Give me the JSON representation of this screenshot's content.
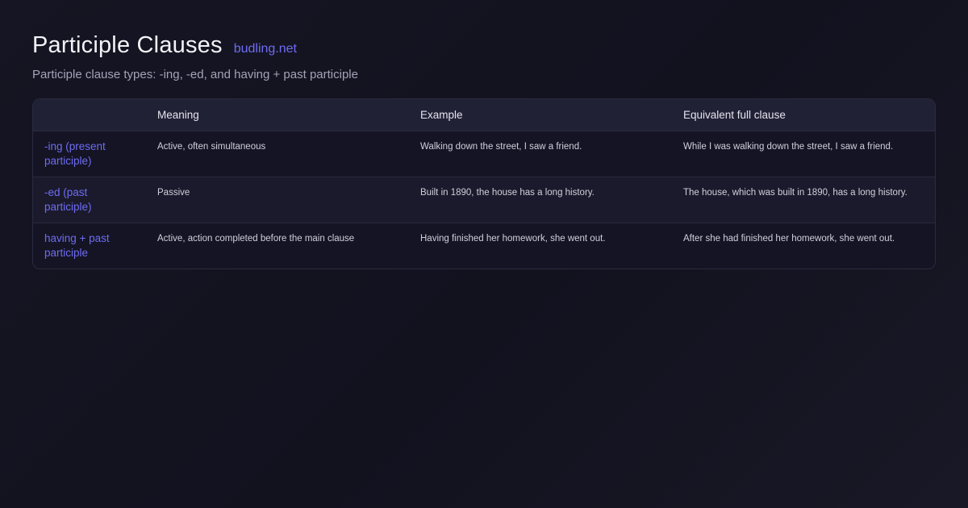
{
  "header": {
    "title": "Participle Clauses",
    "site": "budling.net",
    "subtitle": "Participle clause types: -ing, -ed, and having + past participle"
  },
  "table": {
    "columns": [
      "",
      "Meaning",
      "Example",
      "Equivalent full clause"
    ],
    "rows": [
      {
        "type": "-ing (present participle)",
        "meaning": "Active, often simultaneous",
        "example": "Walking down the street, I saw a friend.",
        "equivalent": "While I was walking down the street, I saw a friend."
      },
      {
        "type": "-ed (past participle)",
        "meaning": "Passive",
        "example": "Built in 1890, the house has a long history.",
        "equivalent": "The house, which was built in 1890, has a long history."
      },
      {
        "type": "having + past participle",
        "meaning": "Active, action completed before the main clause",
        "example": "Having finished her homework, she went out.",
        "equivalent": "After she had finished her homework, she went out."
      }
    ]
  },
  "colors": {
    "accent": "#6f6cf2",
    "background": "#13131f",
    "header_row": "#212136"
  }
}
